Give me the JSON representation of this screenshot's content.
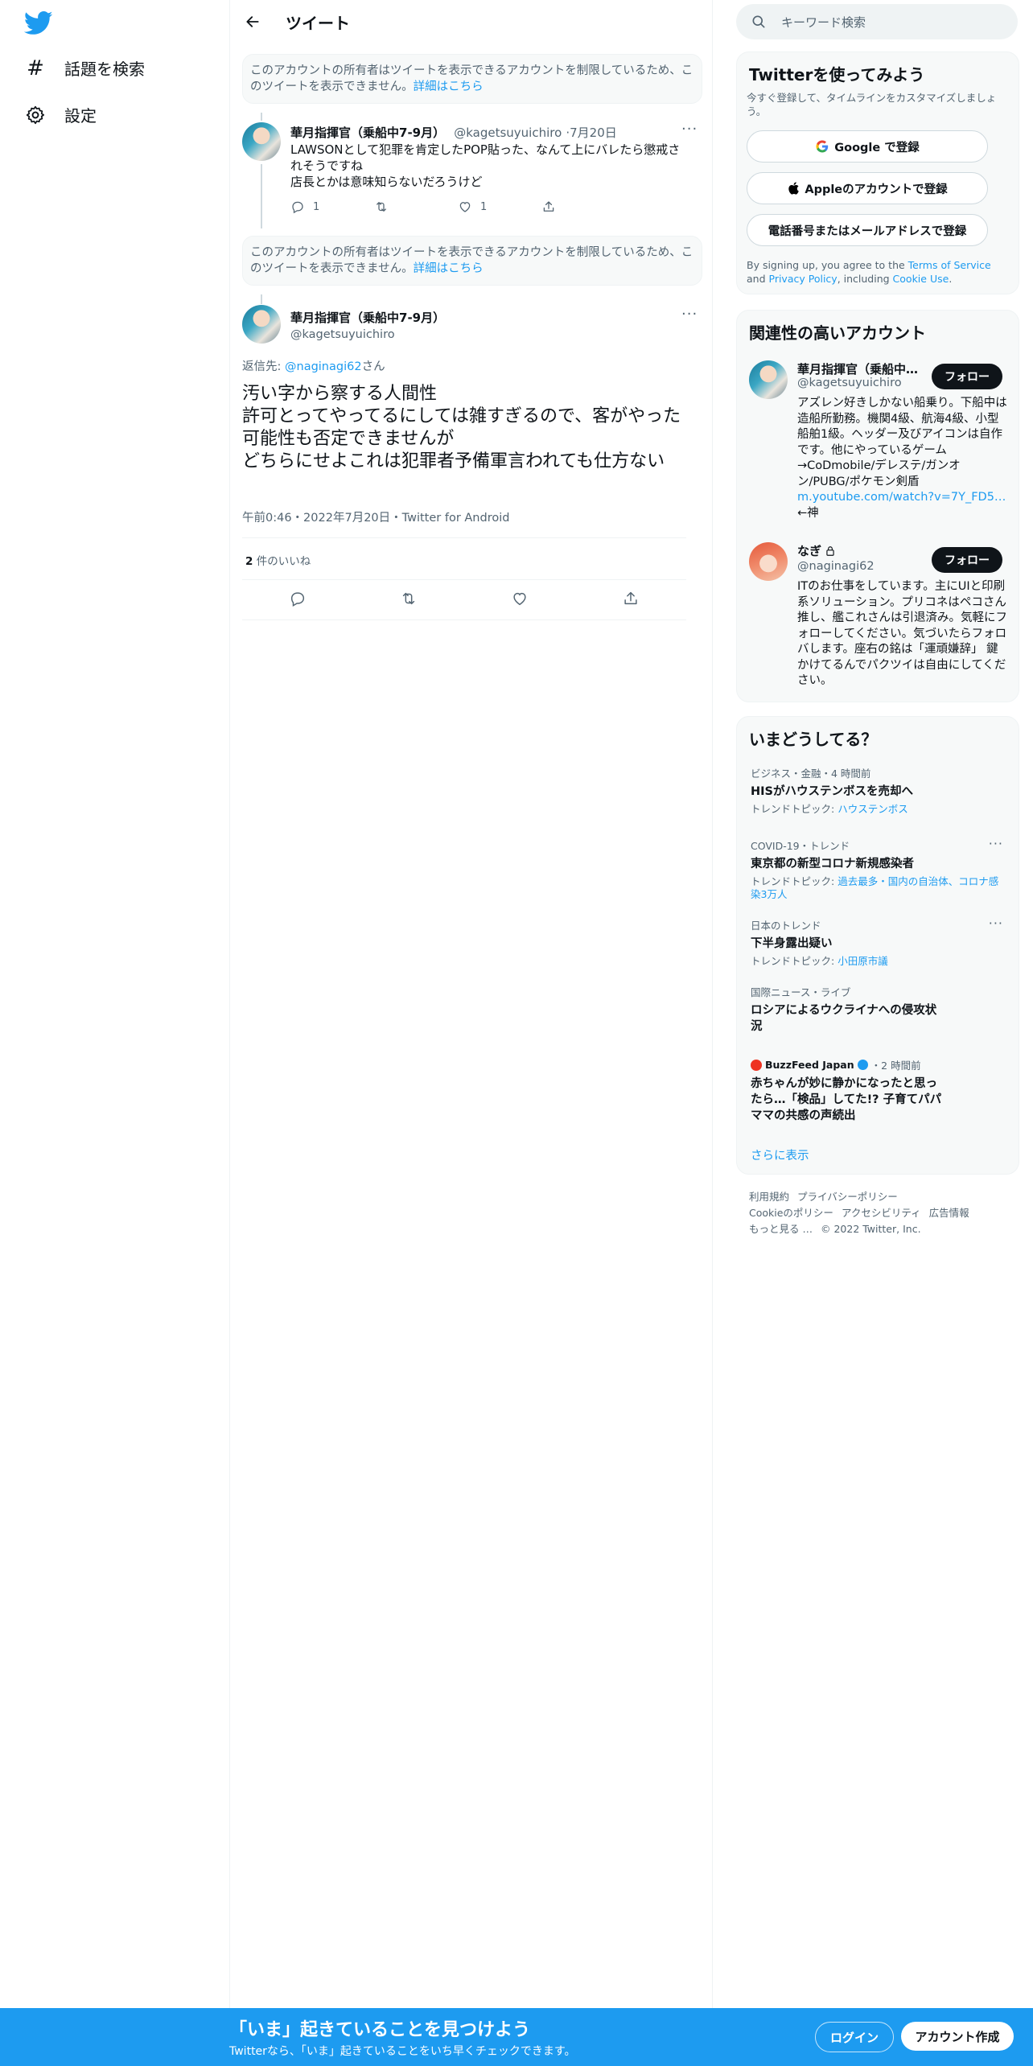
{
  "nav": {
    "explore_label": "話題を検索",
    "settings_label": "設定"
  },
  "header": {
    "title": "ツイート"
  },
  "restricted_notice": {
    "text": "このアカウントの所有者はツイートを表示できるアカウントを制限しているため、このツイートを表示できません。",
    "link": "詳細はこちら"
  },
  "reply_tweet": {
    "name": "華月指揮官（乗船中7-9月）",
    "handle": "@kagetsuyuichiro",
    "date": "7月20日",
    "line1": "LAWSONとして犯罪を肯定したPOP貼った、なんて上にバレたら懲戒されそうですね",
    "line2": "店長とかは意味知らないだろうけど",
    "reply_count": "1",
    "like_count": "1"
  },
  "main_tweet": {
    "name": "華月指揮官（乗船中7-9月）",
    "handle": "@kagetsuyuichiro",
    "reply_to_prefix": "返信先: ",
    "reply_to_handle": "@naginagi62",
    "reply_to_suffix": "さん",
    "line1": "汚い字から察する人間性",
    "line2": "許可とってやってるにしては雑すぎるので、客がやった可能性も否定できませんが",
    "line3": "どちらにせよこれは犯罪者予備軍言われても仕方ない",
    "timestamp": "午前0:46・2022年7月20日・Twitter for Android",
    "likes_count": "2",
    "likes_label": "件のいいね"
  },
  "search": {
    "placeholder": "キーワード検索"
  },
  "signup_panel": {
    "title": "Twitterを使ってみよう",
    "subtitle": "今すぐ登録して、タイムラインをカスタマイズしましょう。",
    "google_label": "Google で登録",
    "apple_label": "Appleのアカウントで登録",
    "phone_label": "電話番号またはメールアドレスで登録",
    "legal_1": "By signing up, you agree to the ",
    "terms": "Terms of Service",
    "legal_2": " and ",
    "privacy": "Privacy Policy",
    "legal_3": ", including ",
    "cookie": "Cookie Use",
    "legal_4": "."
  },
  "relevant": {
    "title": "関連性の高いアカウント",
    "follow_label": "フォロー",
    "accounts": [
      {
        "name": "華月指揮官（乗船中…",
        "handle": "@kagetsuyuichiro",
        "bio": "アズレン好きしかない船乗り。下船中は造船所勤務。機関4級、航海4級、小型船舶1級。ヘッダー及びアイコンは自作です。他にやっているゲーム→CoDmobile/デレステ/ガンオン/PUBG/ポケモン剣盾",
        "link": "m.youtube.com/watch?v=7Y_FD5…",
        "bio_tail": "←神"
      },
      {
        "name": "なぎ",
        "handle": "@naginagi62",
        "bio": "ITのお仕事をしています。主にUIと印刷系ソリューション。プリコネはペコさん推し、艦これさんは引退済み。気軽にフォローしてください。気づいたらフォロバします。座右の銘は「運頑嫌辞」 鍵かけてるんでパクツイは自由にしてください。"
      }
    ]
  },
  "trends": {
    "title": "いまどうしてる？",
    "show_more": "さらに表示",
    "items": [
      {
        "meta": "ビジネス・金融・4 時間前",
        "title": "HISがハウステンボスを売却へ",
        "sub_prefix": "トレンドトピック: ",
        "sub_link": "ハウステンボス"
      },
      {
        "meta": "COVID-19・トレンド",
        "title": "東京都の新型コロナ新規感染者",
        "sub_prefix": "トレンドトピック: ",
        "sub_link": "過去最多・国内の自治体、コロナ感染3万人"
      },
      {
        "meta": "日本のトレンド",
        "title": "下半身露出疑い",
        "sub_prefix": "トレンドトピック: ",
        "sub_link": "小田原市議"
      },
      {
        "meta": "国際ニュース・ライブ",
        "title": "ロシアによるウクライナへの侵攻状況"
      },
      {
        "source": "BuzzFeed Japan",
        "time": "・2 時間前",
        "title": "赤ちゃんが妙に静かになったと思ったら…「検品」してた!? 子育てパパママの共感の声続出"
      }
    ]
  },
  "footer": {
    "links": [
      "利用規約",
      "プライバシーポリシー",
      "Cookieのポリシー",
      "アクセシビリティ",
      "広告情報",
      "もっと見る …"
    ],
    "copyright": "© 2022 Twitter, Inc."
  },
  "bottom_bar": {
    "title": "「いま」起きていることを見つけよう",
    "subtitle": "Twitterなら、「いま」起きていることをいち早くチェックできます。",
    "login": "ログイン",
    "signup": "アカウント作成"
  },
  "colors": {
    "brand": "#1d9bf0",
    "text": "#0f1419",
    "muted": "#536471"
  }
}
